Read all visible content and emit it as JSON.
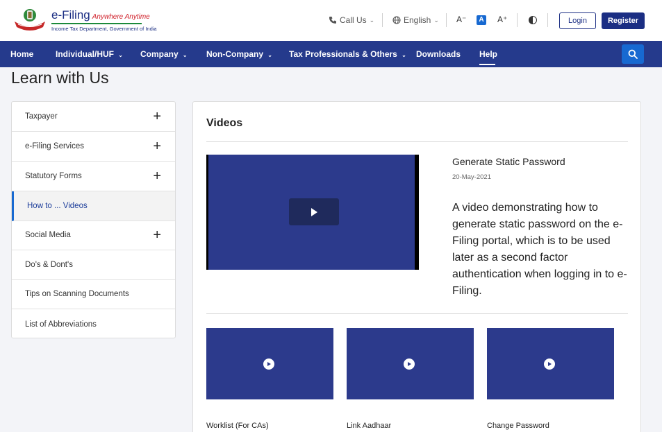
{
  "header": {
    "logo": {
      "title": "e-Filing",
      "tagline": "Anywhere Anytime",
      "subtitle": "Income Tax Department, Government of India"
    },
    "call_us": "Call Us",
    "language": "English",
    "font_decrease": "A⁻",
    "font_normal": "A",
    "font_increase": "A⁺",
    "login": "Login",
    "register": "Register"
  },
  "nav": {
    "items": [
      {
        "label": "Home",
        "dropdown": false
      },
      {
        "label": "Individual/HUF",
        "dropdown": true
      },
      {
        "label": "Company",
        "dropdown": true
      },
      {
        "label": "Non-Company",
        "dropdown": true
      },
      {
        "label": "Tax Professionals & Others",
        "dropdown": true
      },
      {
        "label": "Downloads",
        "dropdown": false
      },
      {
        "label": "Help",
        "dropdown": false,
        "active": true
      }
    ]
  },
  "page": {
    "title": "Learn with Us"
  },
  "sidebar": {
    "items": [
      {
        "label": "Taxpayer",
        "expandable": true
      },
      {
        "label": "e-Filing Services",
        "expandable": true
      },
      {
        "label": "Statutory Forms",
        "expandable": true
      },
      {
        "label": "How to ... Videos",
        "active": true
      },
      {
        "label": "Social Media",
        "expandable": true
      },
      {
        "label": "Do's & Dont's"
      },
      {
        "label": "Tips on Scanning Documents"
      },
      {
        "label": "List of Abbreviations"
      }
    ]
  },
  "main": {
    "section_title": "Videos",
    "featured": {
      "title": "Generate Static Password",
      "date": "20-May-2021",
      "description": "A video demonstrating how to generate static password on the e-Filing portal, which is to be used later as a second factor authentication when logging in to e-Filing."
    },
    "videos": [
      {
        "title": "Worklist (For CAs)"
      },
      {
        "title": "Link Aadhaar"
      },
      {
        "title": "Change Password"
      }
    ]
  },
  "colors": {
    "brand": "#253a8c",
    "accent": "#1769d1",
    "video_bg": "#2c3a8c"
  }
}
